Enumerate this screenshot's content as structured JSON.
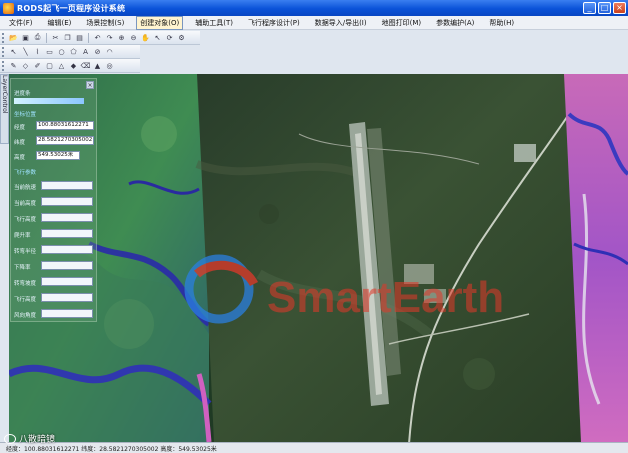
{
  "window": {
    "title": "RODS起飞一页程序设计系统",
    "controls": {
      "minimize": "_",
      "maximize": "□",
      "close": "×"
    }
  },
  "menu": [
    "文件(F)",
    "编辑(E)",
    "场景控制(S)",
    "创建对象(O)",
    "辅助工具(T)",
    "飞行程序设计(P)",
    "数据导入/导出(I)",
    "地图打印(M)",
    "参数编护(A)",
    "帮助(H)"
  ],
  "menu_active_index": 3,
  "toolbar1_icons": [
    "open-icon",
    "save-icon",
    "print-icon",
    "cut-icon",
    "copy-icon",
    "paste-icon",
    "undo-icon",
    "redo-icon",
    "zoom-in-icon",
    "zoom-out-icon",
    "pan-icon",
    "select-icon",
    "refresh-icon",
    "settings-icon"
  ],
  "toolbar2_icons": [
    "pointer-icon",
    "line-icon",
    "polyline-icon",
    "rectangle-icon",
    "circle-icon",
    "polygon-icon",
    "text-icon",
    "measure-icon",
    "arc-icon"
  ],
  "toolbar3_icons": [
    "layer-icon",
    "node-icon",
    "draw-icon",
    "fill-icon",
    "triangle-icon",
    "marker-icon",
    "erase-icon",
    "label-icon",
    "target-icon"
  ],
  "side_tab": "LayerControl",
  "panel": {
    "progress_label": "进度条",
    "location_label": "坐标位置",
    "lon_label": "经度",
    "lon_value": "100.88031612271",
    "lat_label": "纬度",
    "lat_value": "28.5821270305002",
    "alt_label": "高度",
    "alt_value": "549.53025米",
    "aircraft_label": "飞行参数",
    "params": [
      "当前航速",
      "当前高度",
      "飞行高度",
      "爬升率",
      "转弯半径",
      "下降率",
      "转弯坡度",
      "飞行高度",
      "风向角度"
    ]
  },
  "status": "经度：100.88031612271  纬度：28.5821270305002  高度：549.53025米",
  "watermark": "八散暗镜",
  "map_brand": "SmartEarth",
  "colors": {
    "title_blue": "#0a52d8",
    "brand_red": "#e0382a",
    "brand_blue": "#2a7fe0"
  }
}
